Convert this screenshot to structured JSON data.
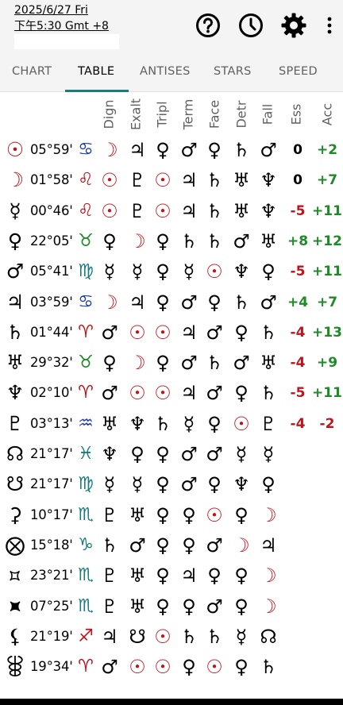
{
  "header": {
    "date": "2025/6/27 Fri",
    "time": "下午5:30 Gmt +8"
  },
  "toolbar": {
    "icons": [
      "help-circle-icon",
      "clock-icon",
      "gear-icon",
      "more-vert-icon"
    ]
  },
  "tabs": [
    {
      "label": "CHART",
      "active": false
    },
    {
      "label": "TABLE",
      "active": true
    },
    {
      "label": "ANTISES",
      "active": false
    },
    {
      "label": "STARS",
      "active": false
    },
    {
      "label": "SPEED",
      "active": false
    }
  ],
  "columns": [
    "Dign",
    "Exalt",
    "Tripl",
    "Term",
    "Face",
    "Detr",
    "Fall",
    "Ess",
    "Acc"
  ],
  "colors": {
    "red": "#c0141c",
    "green": "#1e8a28",
    "teal": "#1c7c7c",
    "blue": "#1e3ea8",
    "tab_underline": "#1c7c7c"
  },
  "rows": [
    {
      "planet": "☉",
      "planet_color": "red",
      "position": "05°59'",
      "sign": "♋",
      "sign_color": "blue",
      "cells": [
        "☽",
        "♃",
        "♀",
        "♂",
        "♀",
        "♄",
        "♂"
      ],
      "ess": "0",
      "ess_color": "black",
      "acc": "+2",
      "acc_color": "green"
    },
    {
      "planet": "☽",
      "planet_color": "red",
      "position": "01°58'",
      "sign": "♌",
      "sign_color": "red",
      "cells": [
        "☉",
        "♇",
        "☉",
        "♃",
        "♄",
        "♅",
        "♆"
      ],
      "ess": "0",
      "ess_color": "black",
      "acc": "+7",
      "acc_color": "green"
    },
    {
      "planet": "☿",
      "planet_color": "black",
      "position": "00°46'",
      "sign": "♌",
      "sign_color": "red",
      "cells": [
        "☉",
        "♇",
        "☉",
        "♃",
        "♄",
        "♅",
        "♆"
      ],
      "ess": "-5",
      "ess_color": "red",
      "acc": "+11",
      "acc_color": "green"
    },
    {
      "planet": "♀",
      "planet_color": "black",
      "position": "22°05'",
      "sign": "♉",
      "sign_color": "green",
      "cells": [
        "♀",
        "☽",
        "♀",
        "♄",
        "♄",
        "♂",
        "♅"
      ],
      "ess": "+8",
      "ess_color": "green",
      "acc": "+12",
      "acc_color": "green"
    },
    {
      "planet": "♂",
      "planet_color": "black",
      "position": "05°41'",
      "sign": "♍",
      "sign_color": "teal",
      "cells": [
        "☿",
        "☿",
        "♀",
        "☿",
        "☉",
        "♆",
        "♀"
      ],
      "ess": "-5",
      "ess_color": "red",
      "acc": "+11",
      "acc_color": "green"
    },
    {
      "planet": "♃",
      "planet_color": "black",
      "position": "03°59'",
      "sign": "♋",
      "sign_color": "blue",
      "cells": [
        "☽",
        "♃",
        "♀",
        "♂",
        "♀",
        "♄",
        "♂"
      ],
      "ess": "+4",
      "ess_color": "green",
      "acc": "+7",
      "acc_color": "green"
    },
    {
      "planet": "♄",
      "planet_color": "black",
      "position": "01°44'",
      "sign": "♈",
      "sign_color": "red",
      "cells": [
        "♂",
        "☉",
        "☉",
        "♃",
        "♂",
        "♀",
        "♄"
      ],
      "ess": "-4",
      "ess_color": "red",
      "acc": "+13",
      "acc_color": "green"
    },
    {
      "planet": "♅",
      "planet_color": "black",
      "position": "29°32'",
      "sign": "♉",
      "sign_color": "green",
      "cells": [
        "♀",
        "☽",
        "♀",
        "♂",
        "♄",
        "♂",
        "♅"
      ],
      "ess": "-4",
      "ess_color": "red",
      "acc": "+9",
      "acc_color": "green"
    },
    {
      "planet": "♆",
      "planet_color": "black",
      "position": "02°10'",
      "sign": "♈",
      "sign_color": "red",
      "cells": [
        "♂",
        "☉",
        "☉",
        "♃",
        "♂",
        "♀",
        "♄"
      ],
      "ess": "-5",
      "ess_color": "red",
      "acc": "+11",
      "acc_color": "green"
    },
    {
      "planet": "♇",
      "planet_color": "black",
      "position": "03°13'",
      "sign": "♒",
      "sign_color": "blue",
      "cells": [
        "♅",
        "♆",
        "♄",
        "☿",
        "♀",
        "☉",
        "♇"
      ],
      "ess": "-4",
      "ess_color": "red",
      "acc": "-2",
      "acc_color": "red"
    },
    {
      "planet": "☊",
      "planet_color": "black",
      "position": "21°17'",
      "sign": "♓",
      "sign_color": "teal",
      "cells": [
        "♆",
        "♀",
        "♀",
        "♂",
        "♂",
        "☿",
        "☿"
      ],
      "ess": "",
      "ess_color": "black",
      "acc": "",
      "acc_color": "black"
    },
    {
      "planet": "☋",
      "planet_color": "black",
      "position": "21°17'",
      "sign": "♍",
      "sign_color": "teal",
      "cells": [
        "☿",
        "☿",
        "♀",
        "♂",
        "♀",
        "♆",
        "♀"
      ],
      "ess": "",
      "ess_color": "black",
      "acc": "",
      "acc_color": "black"
    },
    {
      "planet": "⚳",
      "planet_color": "black",
      "position": "10°17'",
      "sign": "♏",
      "sign_color": "teal",
      "cells": [
        "♇",
        "♅",
        "♀",
        "♀",
        "☉",
        "♀",
        "☽"
      ],
      "ess": "",
      "ess_color": "black",
      "acc": "",
      "acc_color": "black"
    },
    {
      "planet": "⨂",
      "planet_color": "black",
      "position": "15°18'",
      "sign": "♑",
      "sign_color": "teal",
      "cells": [
        "♄",
        "♂",
        "♀",
        "♀",
        "♂",
        "☽",
        "♃"
      ],
      "ess": "",
      "ess_color": "black",
      "acc": "",
      "acc_color": "black"
    },
    {
      "planet": "⯏",
      "planet_color": "black",
      "position": "23°21'",
      "sign": "♏",
      "sign_color": "teal",
      "cells": [
        "♇",
        "♅",
        "♀",
        "♃",
        "♀",
        "♀",
        "☽"
      ],
      "ess": "",
      "ess_color": "black",
      "acc": "",
      "acc_color": "black"
    },
    {
      "planet": "⯍",
      "planet_color": "black",
      "position": "07°25'",
      "sign": "♏",
      "sign_color": "teal",
      "cells": [
        "♇",
        "♅",
        "♀",
        "♀",
        "♂",
        "♀",
        "☽"
      ],
      "ess": "",
      "ess_color": "black",
      "acc": "",
      "acc_color": "black"
    },
    {
      "planet": "⚸",
      "planet_color": "black",
      "position": "21°19'",
      "sign": "♐",
      "sign_color": "red",
      "cells": [
        "♃",
        "☋",
        "☉",
        "♄",
        "♄",
        "☿",
        "☊"
      ],
      "ess": "",
      "ess_color": "black",
      "acc": "",
      "acc_color": "black"
    },
    {
      "planet": "⯚",
      "planet_color": "black",
      "position": "19°34'",
      "sign": "♈",
      "sign_color": "red",
      "cells": [
        "♂",
        "☉",
        "☉",
        "♀",
        "☉",
        "♀",
        "♄"
      ],
      "ess": "",
      "ess_color": "black",
      "acc": "",
      "acc_color": "black"
    }
  ]
}
